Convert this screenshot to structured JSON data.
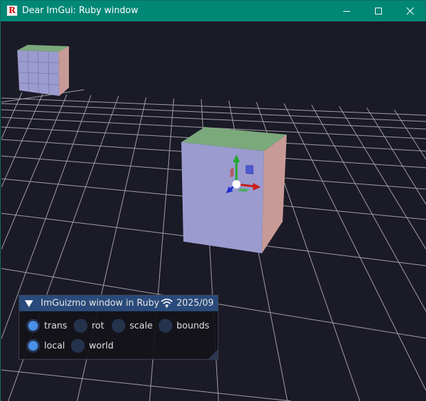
{
  "window": {
    "title": "Dear ImGui: Ruby window",
    "app_icon_glyph": "R",
    "controls": {
      "minimize": "minimize-icon",
      "maximize": "maximize-icon",
      "close": "close-icon"
    },
    "titlebar_color": "#008776",
    "background_color": "#1b1a27"
  },
  "scene": {
    "description_objects": [
      "grid-plane",
      "cube-distant",
      "cube-selected",
      "translate-gizmo"
    ],
    "colors": {
      "cube_top": "#7ba97b",
      "cube_front": "#9b9bcf",
      "cube_side": "#c89a96",
      "grid": "#d8d8d8"
    }
  },
  "panel": {
    "title": "ImGuizmo window in Ruby",
    "date": "2025/09",
    "status_icon": "wifi-icon",
    "header_color": "#294a7a",
    "operations": [
      {
        "label": "trans",
        "selected": true
      },
      {
        "label": "rot",
        "selected": false
      },
      {
        "label": "scale",
        "selected": false
      },
      {
        "label": "bounds",
        "selected": false
      }
    ],
    "modes": [
      {
        "label": "local",
        "selected": true
      },
      {
        "label": "world",
        "selected": false
      }
    ]
  }
}
